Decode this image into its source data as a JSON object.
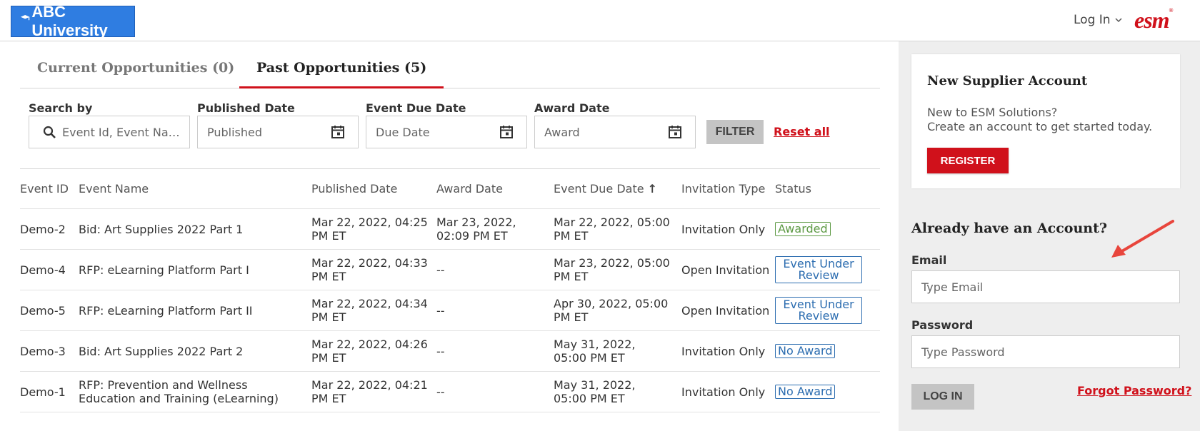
{
  "header": {
    "logo_text": "ABC University",
    "login_label": "Log In",
    "brand": "esm",
    "brand_mark": "®"
  },
  "tabs": [
    {
      "label": "Current Opportunities (0)",
      "active": false
    },
    {
      "label": "Past Opportunities (5)",
      "active": true
    }
  ],
  "filters": {
    "search_label": "Search by",
    "search_placeholder": "Event Id, Event Nam...",
    "published_label": "Published Date",
    "published_placeholder": "Published",
    "due_label": "Event Due Date",
    "due_placeholder": "Due Date",
    "award_label": "Award Date",
    "award_placeholder": "Award",
    "filter_button": "FILTER",
    "reset_link": "Reset all"
  },
  "table": {
    "columns": [
      "Event ID",
      "Event Name",
      "Published Date",
      "Award Date",
      "Event Due Date",
      "Invitation Type",
      "Status"
    ],
    "sort_indicator": "↑",
    "rows": [
      {
        "id": "Demo-2",
        "name": "Bid: Art Supplies 2022 Part 1",
        "published": "Mar 22, 2022, 04:25 PM ET",
        "award": "Mar 23, 2022, 02:09 PM ET",
        "due": "Mar 22, 2022, 05:00 PM ET",
        "invitation": "Invitation Only",
        "status": "Awarded"
      },
      {
        "id": "Demo-4",
        "name": "RFP: eLearning Platform Part I",
        "published": "Mar 22, 2022, 04:33 PM ET",
        "award": "--",
        "due": "Mar 23, 2022, 05:00 PM ET",
        "invitation": "Open Invitation",
        "status": "Event Under Review"
      },
      {
        "id": "Demo-5",
        "name": "RFP: eLearning Platform Part II",
        "published": "Mar 22, 2022, 04:34 PM ET",
        "award": "--",
        "due": "Apr 30, 2022, 05:00 PM ET",
        "invitation": "Open Invitation",
        "status": "Event Under Review"
      },
      {
        "id": "Demo-3",
        "name": "Bid: Art Supplies 2022 Part 2",
        "published": "Mar 22, 2022, 04:26 PM ET",
        "award": "--",
        "due": "May 31, 2022, 05:00 PM ET",
        "invitation": "Invitation Only",
        "status": "No Award"
      },
      {
        "id": "Demo-1",
        "name": "RFP: Prevention and Wellness Education and Training (eLearning)",
        "published": "Mar 22, 2022, 04:21 PM ET",
        "award": "--",
        "due": "May 31, 2022, 05:00 PM ET",
        "invitation": "Invitation Only",
        "status": "No Award"
      }
    ]
  },
  "supplier_card": {
    "title": "New Supplier Account",
    "line1": "New to ESM Solutions?",
    "line2": "Create an account to get started today.",
    "register_button": "REGISTER"
  },
  "login_form": {
    "title": "Already have an Account?",
    "email_label": "Email",
    "email_placeholder": "Type Email",
    "password_label": "Password",
    "password_placeholder": "Type Password",
    "login_button": "LOG IN",
    "forgot_link": "Forgot Password?"
  },
  "colors": {
    "brand_red": "#d0111b",
    "logo_blue": "#2f7de1",
    "awarded_green": "#5e9a45",
    "status_blue": "#2c6db0",
    "arrow_red": "#e8453c"
  }
}
